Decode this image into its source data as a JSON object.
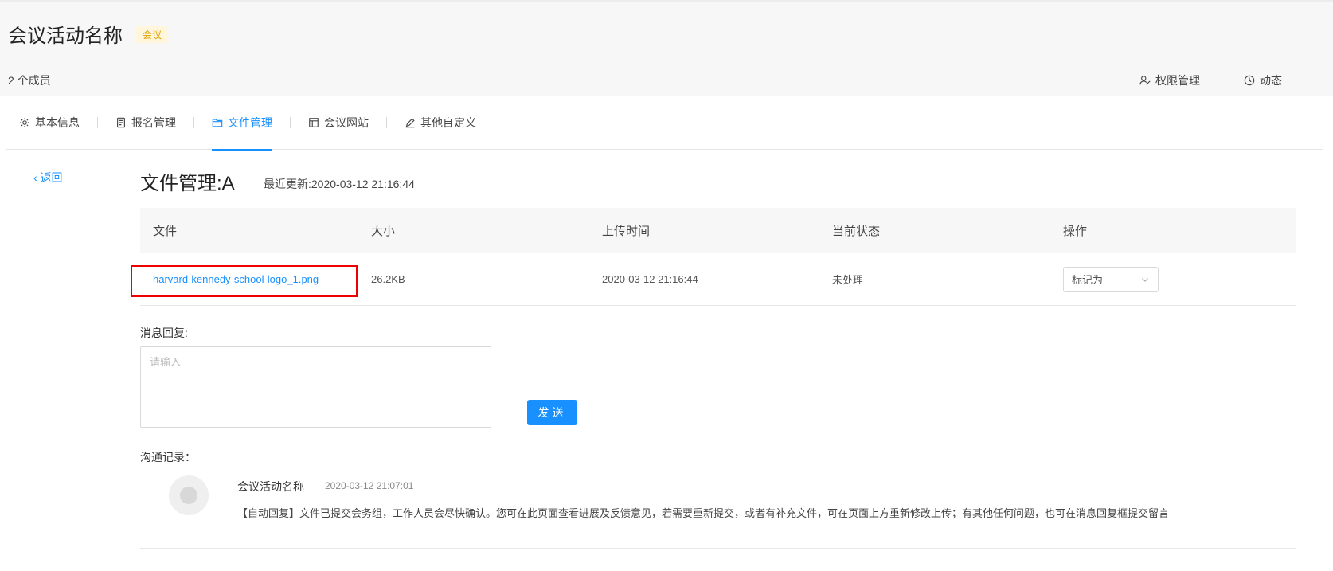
{
  "header": {
    "title": "会议活动名称",
    "tag": "会议",
    "member_count": "2 个成员",
    "actions": {
      "permissions": "权限管理",
      "activity": "动态"
    }
  },
  "tabs": [
    {
      "label": "基本信息",
      "icon": "gear-icon"
    },
    {
      "label": "报名管理",
      "icon": "form-icon"
    },
    {
      "label": "文件管理",
      "icon": "folder-icon",
      "active": true
    },
    {
      "label": "会议网站",
      "icon": "layout-icon"
    },
    {
      "label": "其他自定义",
      "icon": "edit-icon"
    }
  ],
  "back_label": "返回",
  "page": {
    "title": "文件管理:A",
    "last_update": "最近更新:2020-03-12 21:16:44"
  },
  "table": {
    "headers": [
      "文件",
      "大小",
      "上传时间",
      "当前状态",
      "操作"
    ],
    "rows": [
      {
        "file": "harvard-kennedy-school-logo_1.png",
        "size": "26.2KB",
        "uploaded": "2020-03-12 21:16:44",
        "status": "未处理",
        "action": "标记为"
      }
    ]
  },
  "reply": {
    "label": "消息回复:",
    "placeholder": "请输入",
    "send": "发送"
  },
  "log": {
    "label": "沟通记录：",
    "entries": [
      {
        "name": "会议活动名称",
        "time": "2020-03-12 21:07:01",
        "message": "【自动回复】文件已提交会务组，工作人员会尽快确认。您可在此页面查看进展及反馈意见，若需要重新提交，或者有补充文件，可在页面上方重新修改上传；有其他任何问题，也可在消息回复框提交留言"
      }
    ]
  },
  "colors": {
    "accent": "#1890ff",
    "tag_text": "#e0a000",
    "highlight": "#ee0000"
  }
}
